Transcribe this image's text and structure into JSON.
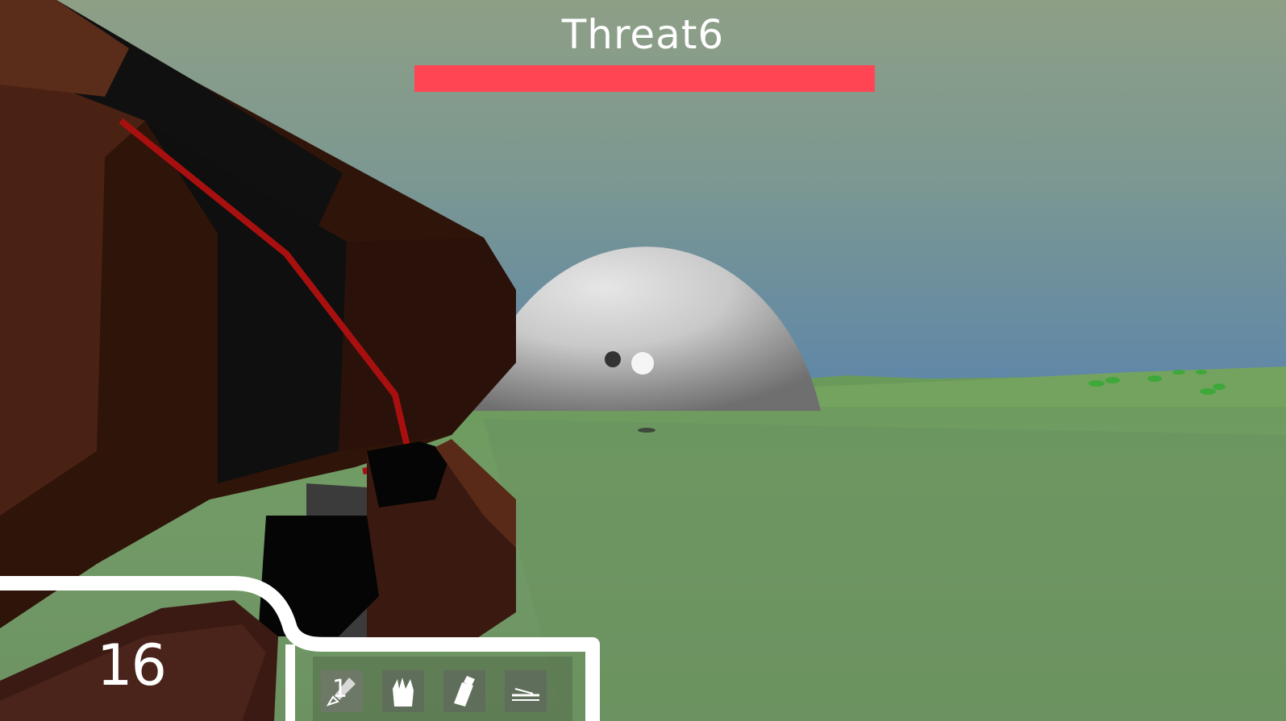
{
  "boss": {
    "name": "Threat6",
    "health_fraction": 1.0,
    "health_color": "#ff4553"
  },
  "hud": {
    "ammo": "16",
    "hotbar": [
      {
        "icon": "dagger-icon",
        "key": "1",
        "selected": true
      },
      {
        "icon": "claw-icon",
        "selected": false
      },
      {
        "icon": "canister-icon",
        "selected": false
      },
      {
        "icon": "arrow-icon",
        "selected": false
      }
    ]
  },
  "colors": {
    "sky_top": "#8a9e88",
    "sky_bottom": "#6b8ea6",
    "ground": "#6f9a64",
    "sphere": "#d9d9d9",
    "weapon_body": "#3a1a10",
    "weapon_stripe": "#b01010",
    "hud_frame": "#ffffff"
  }
}
